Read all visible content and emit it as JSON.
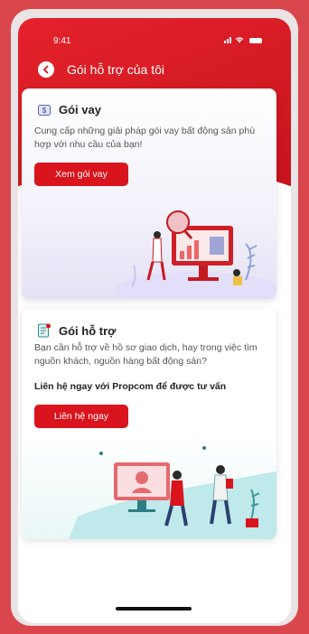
{
  "status_bar": {
    "time": "9:41"
  },
  "header": {
    "title": "Gói hỗ trợ của tôi"
  },
  "cards": [
    {
      "title": "Gói vay",
      "description": "Cung cấp những giải pháp gói vay bất động sản phù hợp với nhu cầu của bạn!",
      "button_label": "Xem gói vay"
    },
    {
      "title": "Gói hỗ trợ",
      "description": "Bạn cần hỗ trợ về hồ sơ giao dịch, hay trong việc tìm nguồn khách, nguồn hàng bất động sản?",
      "emphasis": "Liên hệ ngay với Propcom để được tư vấn",
      "button_label": "Liên hệ ngay"
    }
  ],
  "colors": {
    "brand_red": "#d9141d",
    "background": "#d9474c"
  },
  "icons": [
    "back-arrow-icon",
    "loan-icon",
    "support-document-icon",
    "signal-icon",
    "wifi-icon",
    "battery-icon"
  ]
}
